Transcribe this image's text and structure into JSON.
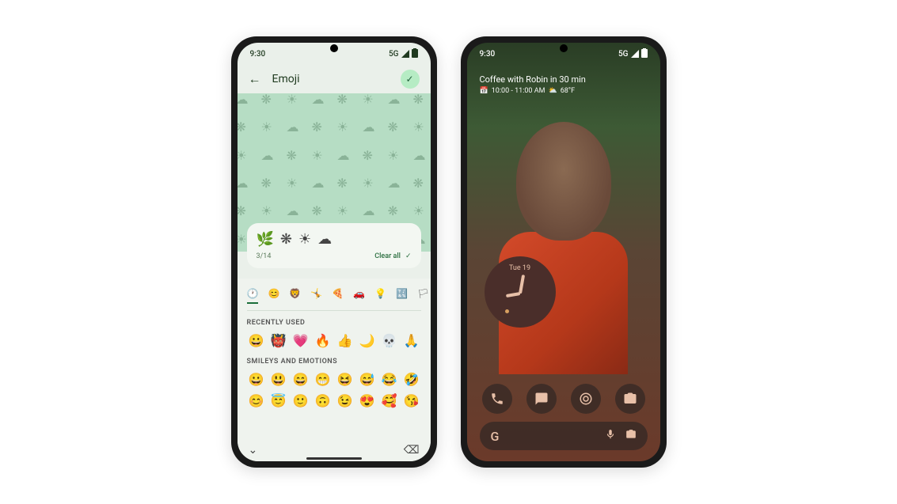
{
  "status": {
    "time": "9:30",
    "network": "5G"
  },
  "phone1": {
    "header_title": "Emoji",
    "selected_emojis": [
      "🌿",
      "❋",
      "☀",
      "☁"
    ],
    "selection_count": "3/14",
    "clear_label": "Clear all",
    "categories": [
      "🕐",
      "😊",
      "🦁",
      "🤸",
      "🍕",
      "🚗",
      "💡",
      "🔣",
      "🏳"
    ],
    "section_recent": "RECENTLY USED",
    "recent_emojis": [
      "😀",
      "👹",
      "💗",
      "🔥",
      "👍",
      "🌙",
      "💀",
      "🙏"
    ],
    "section_smileys": "SMILEYS AND EMOTIONS",
    "smileys_row1": [
      "😀",
      "😃",
      "😄",
      "😁",
      "😆",
      "😅",
      "😂",
      "🤣"
    ],
    "smileys_row2": [
      "😊",
      "😇",
      "🙂",
      "🙃",
      "😉",
      "😍",
      "🥰",
      "😘"
    ]
  },
  "phone2": {
    "glance_title": "Coffee with Robin in 30 min",
    "glance_time": "10:00 - 11:00 AM",
    "glance_temp": "68°F",
    "clock_date": "Tue 19",
    "search_letter": "G",
    "dock": [
      "phone",
      "chat",
      "chrome",
      "camera"
    ]
  }
}
